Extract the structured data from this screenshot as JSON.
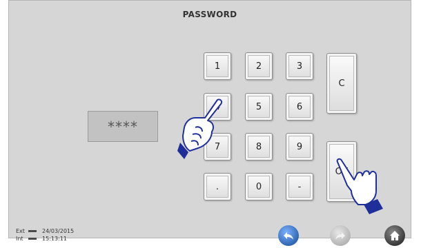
{
  "header": {
    "title": "PASSWORD"
  },
  "display": {
    "masked_value": "****"
  },
  "keypad": {
    "keys": {
      "k1": "1",
      "k2": "2",
      "k3": "3",
      "k4": "4",
      "k5": "5",
      "k6": "6",
      "k7": "7",
      "k8": "8",
      "k9": "9",
      "kdot": ".",
      "k0": "0",
      "kminus": "-"
    },
    "clear_label": "C",
    "ok_label": "OK"
  },
  "status": {
    "ext_label": "Ext",
    "ext_value": "24/03/2015",
    "int_label": "Int",
    "int_value": "15:13:11"
  },
  "footer": {
    "back_icon": "back-arrow-icon",
    "forward_icon": "forward-arrow-icon",
    "home_icon": "home-icon"
  },
  "colors": {
    "back_button": "#2f67b3",
    "disabled_button": "#b5b5b5",
    "home_button": "#3a3a3a",
    "hand_outline": "#1f2f9a"
  }
}
